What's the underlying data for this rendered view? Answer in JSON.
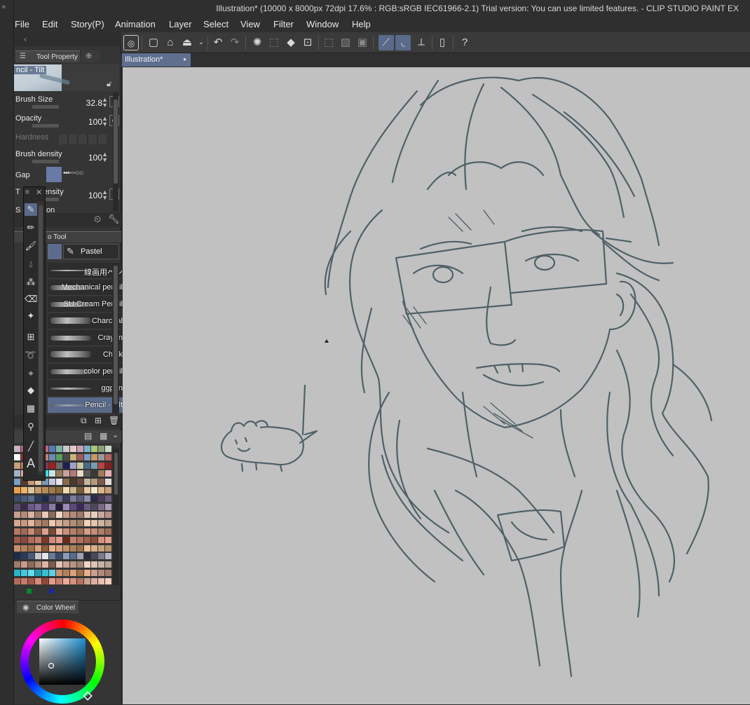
{
  "window": {
    "title": "Illustration* (10000 x 8000px 72dpi 17.6% : RGB:sRGB IEC61966-2.1)  Trial version: You can use limited features. - CLIP STUDIO PAINT EX"
  },
  "menu": [
    "File",
    "Edit",
    "Story(P)",
    "Animation",
    "Layer",
    "Select",
    "View",
    "Filter",
    "Window",
    "Help"
  ],
  "toolbar_icons": [
    "app-icon",
    "new-canvas-icon",
    "open-icon",
    "save-icon",
    "undo-icon",
    "redo-icon",
    "clear-icon",
    "fill-icon",
    "transform-icon",
    "deselect-icon",
    "snap-ruler-icon",
    "snap-special-ruler-icon",
    "snap-grid-icon",
    "smartphone-icon",
    "help-icon"
  ],
  "left_strip": {
    "toggle": "»"
  },
  "document_tab": {
    "label": "Illustration*",
    "close": "●"
  },
  "tool_property": {
    "tab_label": "Tool Property",
    "current_brush": "ncil - Tilt",
    "rows": [
      {
        "label": "Brush Size",
        "value": "32.8"
      },
      {
        "label": "Opacity",
        "value": "100"
      },
      {
        "label": "Hardness",
        "value": ""
      },
      {
        "label": "Brush density",
        "value": "100"
      },
      {
        "label": "Gap",
        "value": ""
      },
      {
        "label": "T",
        "value": "100",
        "suffix": "ensity"
      },
      {
        "label": "S",
        "value": "",
        "suffix": "on"
      }
    ]
  },
  "sub_tool": {
    "tab_label": "o Tool",
    "active_tab": "Pastel",
    "brushes": [
      "線画用ペン",
      "Mechanical pencil",
      "SU Cream Pencil",
      "Charcoal",
      "Crayon",
      "Chalk",
      "color pencil",
      "ggpen",
      "Pencil - Tilt"
    ]
  },
  "color_wheel": {
    "tab_label": "Color Wheel"
  },
  "colors": {
    "canvas": "#c1c1c1",
    "sketch_line": "#4f6168",
    "accent": "#5f6f8f",
    "panel": "#353535"
  }
}
